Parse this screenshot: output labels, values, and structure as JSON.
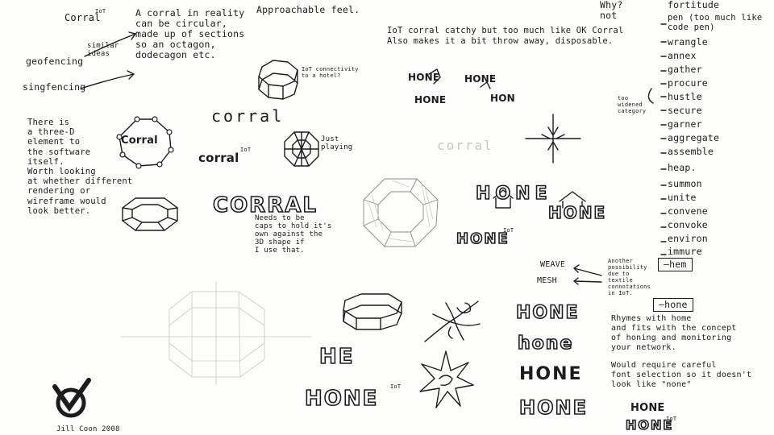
{
  "sheet": {
    "corral_tag": "Corral",
    "corral_tag_mark": "IoT",
    "circular_note": "A corral in reality\ncan be circular,\nmade up of sections\nso an octagon,\ndodecagon etc.",
    "similar_ideas": "similar\nideas",
    "geofencing": "geofencing",
    "singfencing": "singfencing",
    "approachable": "Approachable feel.",
    "connectivity_note": "IoT connectivity\nto a hotel?",
    "iot_note": "IoT corral catchy but too much like OK Corral\nAlso makes it a bit throw away, disposable.",
    "why_not": "Why?\nnot",
    "three_d_note": "There is\na three-D\nelement to\nthe software\nitself.\nWorth looking\nat whether different\nrendering or\nwireframe would\nlook better.",
    "corral_logo": "Corral",
    "corral_lower": "corral",
    "corral_iot": "corral",
    "iot_mark": "IoT",
    "just_playing": "Just\nplaying",
    "corral_caps": "CORRAL",
    "caps_note": "Needs to be\ncaps to hold it's\nown against the\n3D shape if\nI use that.",
    "faint_corral": "corral",
    "hone_small_1": "HONE",
    "hone_small_2": "HONE",
    "hone_small_3": "HONE",
    "hon_small": "HON",
    "hone_mid": "HONE",
    "hone_iot": "HONE",
    "hone_big_1": "HE",
    "hone_big_2": "HONE",
    "hone_stack": [
      "HONE",
      "hone",
      "HONE",
      "HONE"
    ],
    "hone_br_1": "HONE",
    "hone_br_2": "HONE",
    "weave": "WEAVE",
    "mesh": "MESH",
    "another_note": "Another\npossibility\ndue to\ntextile\nconnotations\nin IoT.",
    "hem_box": "—hem",
    "hone_box": "—hone",
    "rhymes_note": "Rhymes with home\nand fits with the concept\nof honing and monitoring\nyour network.",
    "require_note": "Would require careful\nfont selection so it doesn't\nlook like \"none\"",
    "widen_note": "too\nwidened\ncategory",
    "word_list": [
      "fortitude",
      "pen (too much like\ncode pen)",
      "wrangle",
      "annex",
      "gather",
      "procure",
      "hustle",
      "secure",
      "garner",
      "aggregate",
      "assemble",
      "heap.",
      "summon",
      "unite",
      "convene",
      "convoke",
      "environ",
      "immure"
    ],
    "signature": "Jill Coon 2008"
  }
}
